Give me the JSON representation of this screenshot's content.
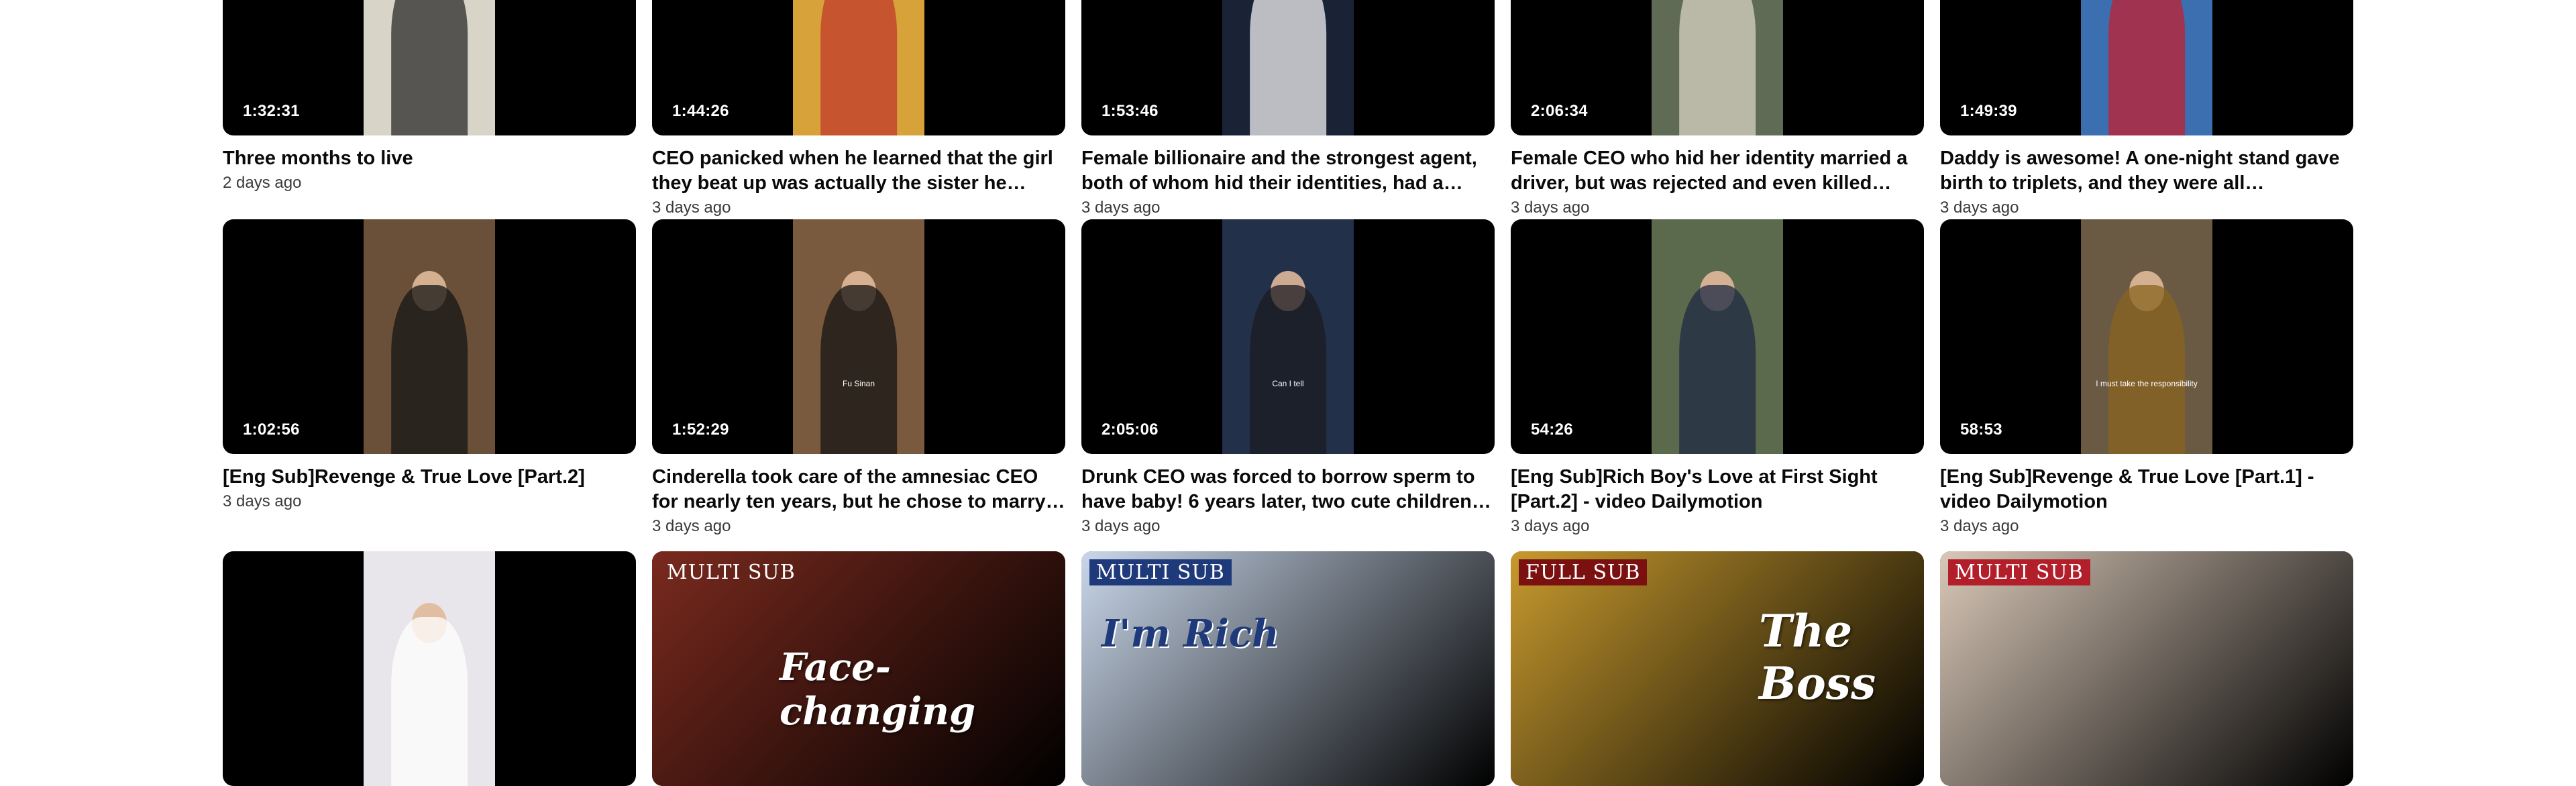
{
  "videos": [
    {
      "title": "Three months to live",
      "age": "2 days ago",
      "duration": "1:32:31",
      "frame_color": "#d9d4c8",
      "fig_color": "#2b2b2b",
      "caption": ""
    },
    {
      "title": "CEO panicked when he learned that the girl they beat up was actually the sister he was…",
      "age": "3 days ago",
      "duration": "1:44:26",
      "frame_color": "#d7a23a",
      "fig_color": "#c0392b",
      "caption": ""
    },
    {
      "title": "Female billionaire and the strongest agent, both of whom hid their identities, had a flash…",
      "age": "3 days ago",
      "duration": "1:53:46",
      "frame_color": "#1a2236",
      "fig_color": "#f2f2f2",
      "caption": ""
    },
    {
      "title": "Female CEO who hid her identity married a driver, but was rejected and even killed her…",
      "age": "3 days ago",
      "duration": "2:06:34",
      "frame_color": "#5f6b55",
      "fig_color": "#d8d2c2",
      "caption": ""
    },
    {
      "title": "Daddy is awesome! A one-night stand gave birth to triplets, and they were all reincarnate…",
      "age": "3 days ago",
      "duration": "1:49:39",
      "frame_color": "#3b6fb0",
      "fig_color": "#c21f30",
      "caption": ""
    },
    {
      "title": "[Eng Sub]Revenge & True Love [Part.2]",
      "age": "3 days ago",
      "duration": "1:02:56",
      "frame_color": "#6a5038",
      "fig_color": "#151515",
      "caption": ""
    },
    {
      "title": "Cinderella took care of the amnesiac CEO for nearly ten years, but he chose to marry his ric…",
      "age": "3 days ago",
      "duration": "1:52:29",
      "frame_color": "#7a5a3e",
      "fig_color": "#141414",
      "caption": "Fu Sinan"
    },
    {
      "title": "Drunk CEO was forced to borrow sperm to have baby! 6 years later, two cute children…",
      "age": "3 days ago",
      "duration": "2:05:06",
      "frame_color": "#223049",
      "fig_color": "#1b1b22",
      "caption": "Can I tell"
    },
    {
      "title": "[Eng Sub]Rich Boy's Love at First Sight [Part.2] - video Dailymotion",
      "age": "3 days ago",
      "duration": "54:26",
      "frame_color": "#5b6a4c",
      "fig_color": "#1f2a44",
      "caption": ""
    },
    {
      "title": "[Eng Sub]Revenge & True Love [Part.1] - video Dailymotion",
      "age": "3 days ago",
      "duration": "58:53",
      "frame_color": "#6b5a43",
      "fig_color": "#8a6420",
      "caption": "I must take the responsibility"
    }
  ],
  "posters": [
    {
      "badge": "",
      "title": "",
      "bg": "#000000"
    },
    {
      "badge": "MULTI SUB",
      "title": "Face-changing",
      "bg": "#7a2a1e"
    },
    {
      "badge": "MULTI SUB",
      "title": "I'm Rich",
      "bg": "#c9d7ea"
    },
    {
      "badge": "FULL SUB",
      "title": "The Boss",
      "bg": "#c89a2e"
    },
    {
      "badge": "MULTI SUB",
      "title": "",
      "bg": "#d9c8b8"
    }
  ]
}
